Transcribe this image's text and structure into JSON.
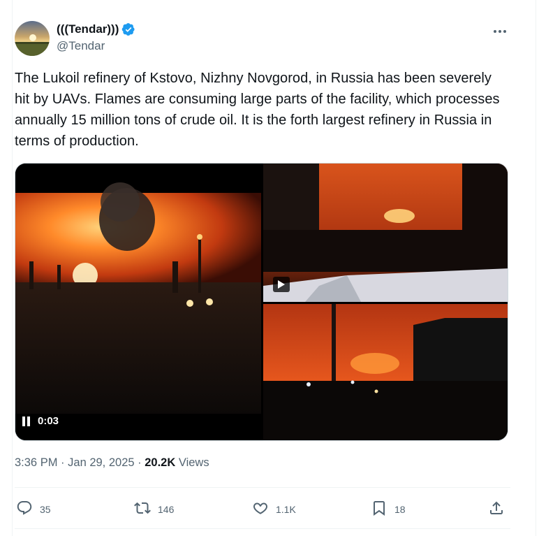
{
  "tweet": {
    "author": {
      "display_name": "(((Tendar)))",
      "handle": "@Tendar",
      "verified": true
    },
    "text": "The Lukoil refinery of Kstovo, Nizhny Novgorod, in Russia has been severely hit by UAVs. Flames are consuming large parts of the facility, which processes annually 15 million tons of crude oil. It is the forth largest refinery in Russia in terms of production.",
    "media": {
      "video_time": "0:03"
    },
    "meta": {
      "time": "3:36 PM",
      "sep1": "·",
      "date": "Jan 29, 2025",
      "sep2": "·",
      "views_count": "20.2K",
      "views_label": "Views"
    },
    "actions": {
      "replies": "35",
      "reposts": "146",
      "likes": "1.1K",
      "bookmarks": "18"
    }
  },
  "icons": {
    "more": "more-horizontal-icon",
    "reply": "reply-icon",
    "repost": "repost-icon",
    "like": "heart-icon",
    "bookmark": "bookmark-icon",
    "share": "share-icon"
  },
  "colors": {
    "verified": "#1d9bf0",
    "secondary_text": "#536471",
    "primary_text": "#0f1419"
  }
}
